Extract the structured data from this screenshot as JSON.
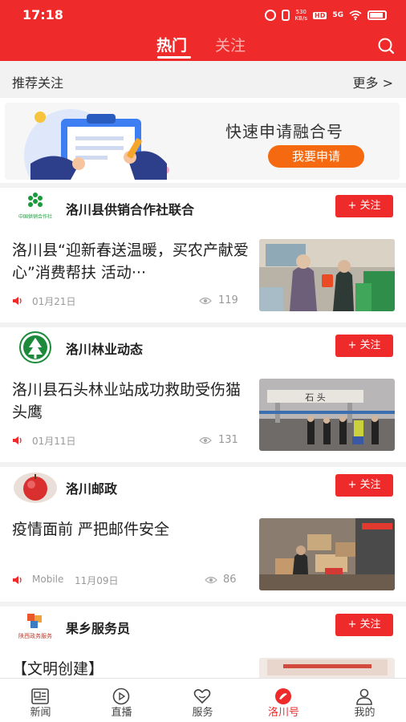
{
  "status_bar": {
    "time": "17:18",
    "net_speed": "530\nKB/s",
    "hd": "HD",
    "signal": "5G"
  },
  "top_tabs": {
    "hot": "热门",
    "follow": "关注"
  },
  "recommend": {
    "title": "推荐关注",
    "more": "更多 >"
  },
  "banner": {
    "title": "快速申请融合号",
    "button": "我要申请"
  },
  "follow_label": "+ 关注",
  "accounts": [
    {
      "name": "洛川县供销合作社联合",
      "logo_text": "中国供销合作社",
      "article": {
        "title": "洛川县“迎新春送温暖，买农产献爱心”消费帮扶 活动···",
        "source": "",
        "date": "01月21日",
        "views": "119"
      }
    },
    {
      "name": "洛川林业动态",
      "article": {
        "title": "洛川县石头林业站成功救助受伤猫头鹰",
        "source": "",
        "date": "01月11日",
        "views": "131",
        "thumb_sign": "石 头"
      }
    },
    {
      "name": "洛川邮政",
      "article": {
        "title": "疫情面前 严把邮件安全",
        "source": "Mobile",
        "date": "11月09日",
        "views": "86"
      }
    },
    {
      "name": "果乡服务员",
      "logo_text": "陕西政务服务",
      "article": {
        "title": "【文明创建】",
        "source": "",
        "date": "",
        "views": ""
      }
    }
  ],
  "bottom_nav": [
    {
      "label": "新闻",
      "icon": "news-icon"
    },
    {
      "label": "直播",
      "icon": "live-icon"
    },
    {
      "label": "服务",
      "icon": "service-icon"
    },
    {
      "label": "洛川号",
      "icon": "luochuan-hao-icon",
      "active": true
    },
    {
      "label": "我的",
      "icon": "profile-icon"
    }
  ],
  "colors": {
    "brand_red": "#ee2b2a",
    "apply_orange": "#f56a10"
  }
}
